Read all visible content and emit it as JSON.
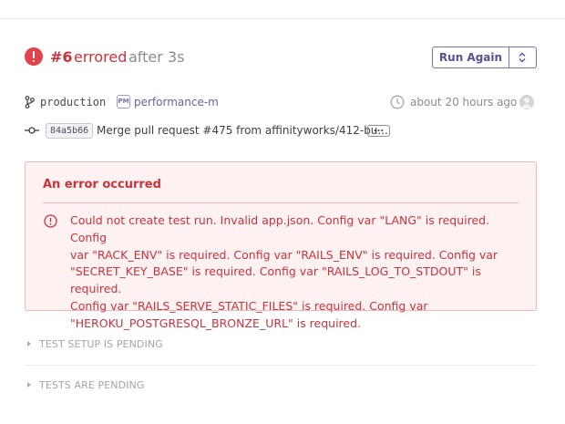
{
  "header": {
    "run_number": "#6",
    "status": "errored",
    "duration": "after 3s",
    "run_again_label": "Run Again"
  },
  "meta": {
    "branch": "production",
    "app_badge": "PM",
    "app_name": "performance-m",
    "time_ago": "about 20 hours ago"
  },
  "commit": {
    "sha": "84a5b66",
    "message": "Merge pull request #475 from affinityworks/412-bu...",
    "more_label": "..."
  },
  "error": {
    "title": "An error occurred",
    "message_lines": [
      "Could not create test run. Invalid app.json. Config var \"LANG\" is required. Config",
      "var \"RACK_ENV\" is required. Config var \"RAILS_ENV\" is required. Config var",
      "\"SECRET_KEY_BASE\" is required. Config var \"RAILS_LOG_TO_STDOUT\" is required.",
      "Config var \"RAILS_SERVE_STATIC_FILES\" is required. Config var",
      "\"HEROKU_POSTGRESQL_BRONZE_URL\" is required."
    ]
  },
  "sections": [
    {
      "label": "TEST SETUP IS PENDING"
    },
    {
      "label": "TESTS ARE PENDING"
    }
  ],
  "colors": {
    "error": "#c9333c",
    "accent": "#6a5ca8",
    "error_panel_bg": "#fdf1f1"
  },
  "icons": [
    "error-status-icon",
    "chevron-up-down-icon",
    "git-branch-icon",
    "clock-icon",
    "user-avatar-icon",
    "git-commit-icon",
    "error-circle-icon",
    "triangle-right-icon"
  ]
}
